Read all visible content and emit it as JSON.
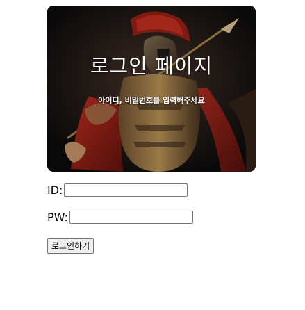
{
  "hero": {
    "title": "로그인 페이지",
    "subtitle": "아이디, 비밀번호를 입력해주세요"
  },
  "form": {
    "id_label": "ID:",
    "id_value": "",
    "pw_label": "PW:",
    "pw_value": "",
    "submit_label": "로그인하기"
  },
  "colors": {
    "hero_background": "#0c0a0b",
    "cape_red": "#8a1c12",
    "armor_bronze": "#8b6a3c"
  }
}
